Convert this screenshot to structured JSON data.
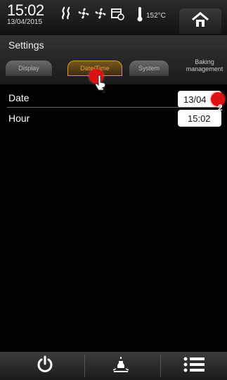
{
  "status": {
    "time": "15:02",
    "date": "13/04/2015",
    "temperature": "152°C"
  },
  "settings": {
    "title": "Settings",
    "tabs": [
      {
        "label": "Display"
      },
      {
        "label": "Date/Time"
      },
      {
        "label": "System"
      },
      {
        "label": "Baking management"
      }
    ]
  },
  "datetime": {
    "date_label": "Date",
    "date_value": "13/04",
    "hour_label": "Hour",
    "hour_value": "15:02"
  },
  "annotations": {
    "step1": "1",
    "step2": "2"
  },
  "colors": {
    "active_tab": "#f0a030",
    "marker": "#d11111"
  }
}
